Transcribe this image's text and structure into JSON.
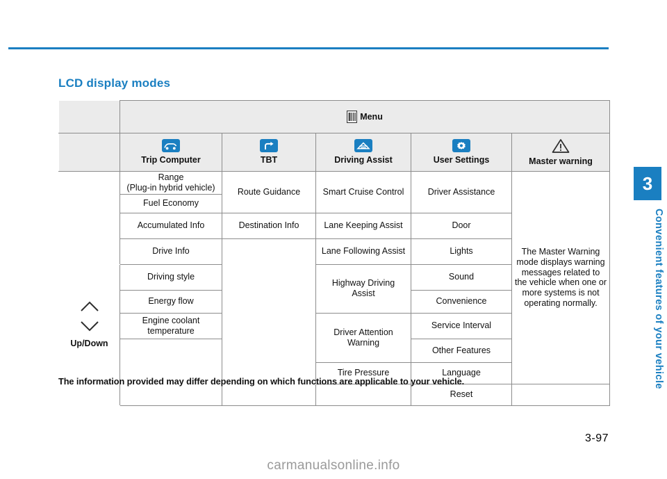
{
  "page": {
    "number": "3-97",
    "side_tab_number": "3",
    "side_tab_text": "Convenient features of your vehicle",
    "watermark": "carmanualsonline.info"
  },
  "heading": "LCD display modes",
  "note": "The information provided may differ depending on which functions are applicable to your vehicle.",
  "table": {
    "menu_header": "Menu",
    "updown_label": "Up/Down",
    "categories": [
      {
        "label": "Trip Computer",
        "icon": "trip-computer-icon"
      },
      {
        "label": "TBT",
        "icon": "turn-by-turn-icon"
      },
      {
        "label": "Driving Assist",
        "icon": "driving-assist-icon"
      },
      {
        "label": "User Settings",
        "icon": "user-settings-gear-icon"
      },
      {
        "label": "Master warning",
        "icon": "warning-triangle-icon"
      }
    ],
    "trip_computer": [
      "Range\n(Plug-in hybrid vehicle)",
      "Fuel Economy",
      "Accumulated Info",
      "Drive Info",
      "Driving style",
      "Energy flow",
      "Engine coolant\ntemperature"
    ],
    "trip_computer_rows": {
      "range": "Range",
      "range_sub": "(Plug-in hybrid vehicle)",
      "fuel_economy": "Fuel Economy",
      "accumulated_info": "Accumulated Info",
      "drive_info": "Drive Info",
      "driving_style": "Driving style",
      "energy_flow": "Energy flow",
      "engine_coolant": "Engine coolant",
      "engine_coolant_2": "temperature"
    },
    "tbt": {
      "route_guidance": "Route Guidance",
      "destination_info": "Destination Info"
    },
    "driving_assist": {
      "smart_cruise_control": "Smart Cruise Control",
      "lane_keeping_assist": "Lane Keeping Assist",
      "lane_following_assist": "Lane Following Assist",
      "highway_driving": "Highway Driving",
      "highway_driving_2": "Assist",
      "driver_attention": "Driver Attention",
      "driver_attention_2": "Warning",
      "tire_pressure": "Tire Pressure"
    },
    "user_settings": {
      "driver_assistance": "Driver Assistance",
      "door": "Door",
      "lights": "Lights",
      "sound": "Sound",
      "convenience": "Convenience",
      "service_interval": "Service Interval",
      "other_features": "Other Features",
      "language": "Language",
      "reset": "Reset"
    },
    "master_warning": {
      "text": "The Master Warning mode displays warning messages related to the vehicle when one or more systems is not operating normally."
    }
  },
  "colors": {
    "accent": "#1a7fc1",
    "header_bg": "#ebebeb",
    "border": "#8c8c8c"
  }
}
